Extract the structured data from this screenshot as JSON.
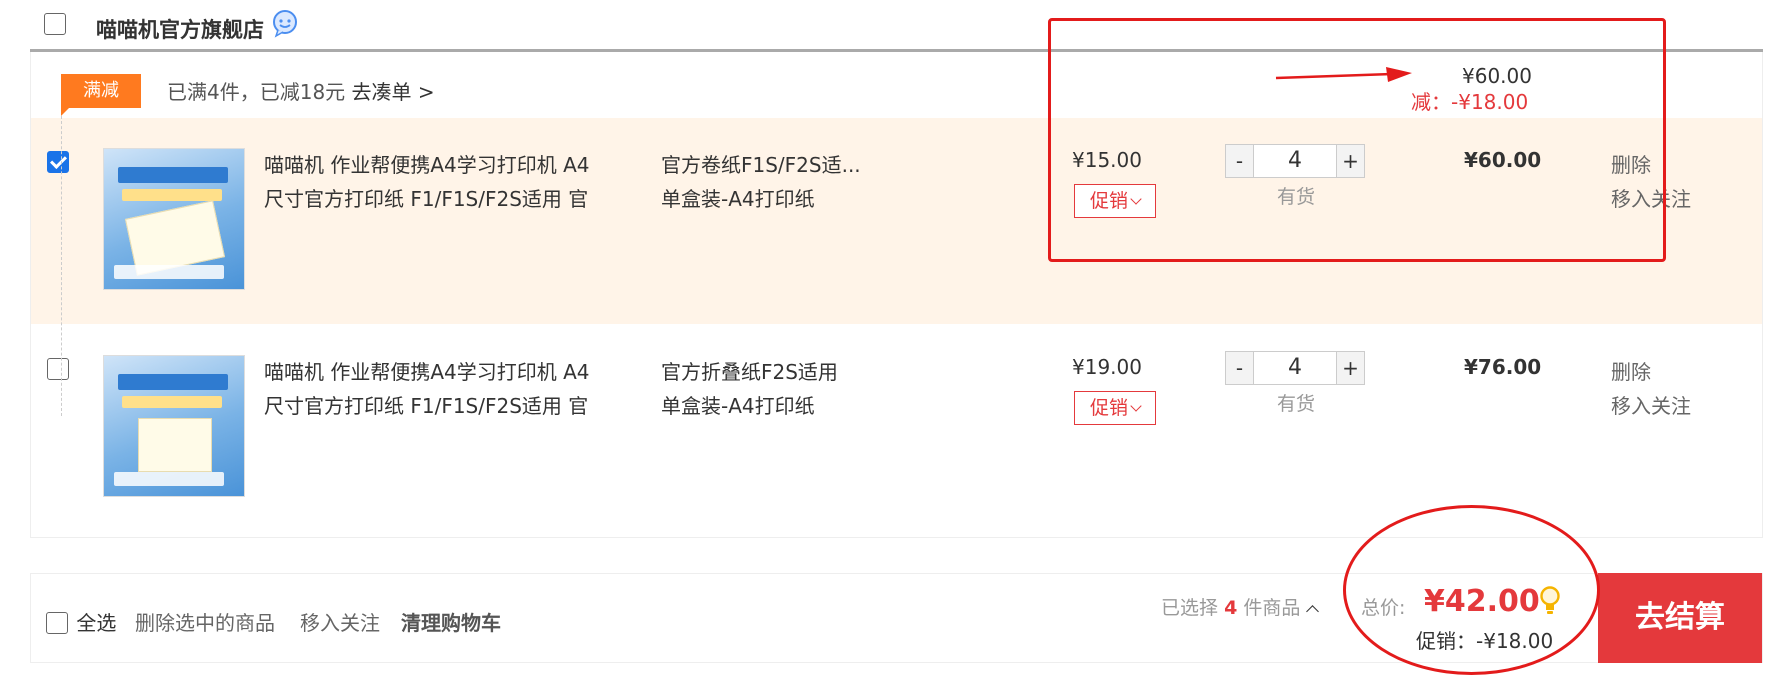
{
  "shop": {
    "name": "喵喵机官方旗舰店"
  },
  "promotion": {
    "tag": "满减",
    "text": "已满4件，已减18元",
    "link": "去凑单 >",
    "original_total": "¥60.00",
    "discount": "减：-¥18.00"
  },
  "items": [
    {
      "checked": true,
      "title": "喵喵机 作业帮便携A4学习打印机 A4尺寸官方打印纸 F1/F1S/F2S适用 官方卷纸",
      "spec_line1": "官方卷纸F1S/F2S适...",
      "spec_line2": "单盒装-A4打印纸",
      "price": "¥15.00",
      "promo_button": "促销",
      "quantity": "4",
      "minus": "-",
      "plus": "+",
      "stock": "有货",
      "subtotal": "¥60.00",
      "delete": "删除",
      "follow": "移入关注"
    },
    {
      "checked": false,
      "title": "喵喵机 作业帮便携A4学习打印机 A4尺寸官方打印纸 F1/F1S/F2S适用 官方折叠纸",
      "spec_line1": "官方折叠纸F2S适用",
      "spec_line2": "单盒装-A4打印纸",
      "price": "¥19.00",
      "promo_button": "促销",
      "quantity": "4",
      "minus": "-",
      "plus": "+",
      "stock": "有货",
      "subtotal": "¥76.00",
      "delete": "删除",
      "follow": "移入关注"
    }
  ],
  "footer": {
    "select_all": "全选",
    "delete_selected": "删除选中的商品",
    "move_to_follow": "移入关注",
    "clear_cart": "清理购物车",
    "selected_prefix": "已选择",
    "selected_count": "4",
    "selected_suffix": "件商品",
    "total_label": "总价:",
    "total_value": "¥42.00",
    "promo_total": "促销：-¥18.00",
    "checkout": "去结算"
  },
  "colors": {
    "accent_red": "#e4393c",
    "promo_orange": "#ff7a1f",
    "selected_row_bg": "#fff4e8",
    "annotation_red": "#e31b1b",
    "checkbox_blue": "#1a73e8"
  },
  "icons": {
    "shop_chat": "chat-bubble-icon",
    "savings_tip": "lightbulb-icon"
  }
}
